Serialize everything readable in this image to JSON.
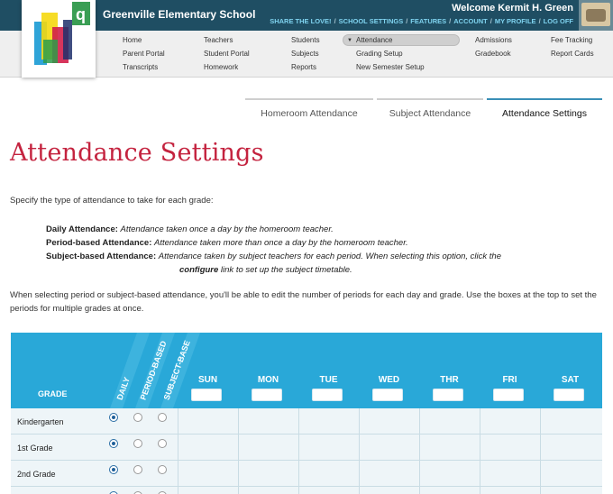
{
  "header": {
    "school_name": "Greenville Elementary School",
    "welcome": "Welcome Kermit H. Green",
    "links": [
      "SHARE THE LOVE!",
      "SCHOOL SETTINGS",
      "FEATURES",
      "ACCOUNT",
      "MY PROFILE",
      "LOG OFF"
    ],
    "logo_letter": "q"
  },
  "nav": {
    "col1": [
      "Home",
      "Parent Portal",
      "Transcripts"
    ],
    "col2": [
      "Teachers",
      "Student Portal",
      "Homework"
    ],
    "col3": [
      "Students",
      "Subjects",
      "Reports"
    ],
    "col4": [
      "Attendance",
      "Grading Setup",
      "New Semester Setup"
    ],
    "col5": [
      "Admissions",
      "Gradebook"
    ],
    "col6": [
      "Fee Tracking",
      "Report Cards"
    ]
  },
  "tabs": [
    "Homeroom Attendance",
    "Subject Attendance",
    "Attendance Settings"
  ],
  "title": "Attendance Settings",
  "intro": "Specify the type of attendance to take for each grade:",
  "definitions": {
    "daily_term": "Daily Attendance:",
    "daily_desc": "Attendance taken once a day by the homeroom teacher.",
    "period_term": "Period-based Attendance:",
    "period_desc": "Attendance taken more than once a day by the homeroom teacher.",
    "subject_term": "Subject-based Attendance:",
    "subject_desc": "Attendance taken by subject teachers for each period. When selecting this option, click the",
    "configure": "configure",
    "subject_desc_2": "link to set up the subject timetable."
  },
  "note": "When selecting period or subject-based attendance, you'll be able to edit the number of periods for each day and grade. Use the boxes at the top to set the periods for multiple grades at once.",
  "table": {
    "grade_header": "GRADE",
    "type_headers": [
      "DAILY",
      "PERIOD-BASED",
      "SUBJECT-BASE"
    ],
    "days": [
      "SUN",
      "MON",
      "TUE",
      "WED",
      "THR",
      "FRI",
      "SAT"
    ],
    "rows": [
      {
        "grade": "Kindergarten",
        "selected": "daily"
      },
      {
        "grade": "1st Grade",
        "selected": "daily"
      },
      {
        "grade": "2nd Grade",
        "selected": "daily"
      },
      {
        "grade": "",
        "selected": "daily"
      }
    ]
  },
  "colors": {
    "topbar": "#1f4e63",
    "accent": "#29a8d8",
    "title": "#c4233f",
    "link": "#7fd3ef"
  }
}
